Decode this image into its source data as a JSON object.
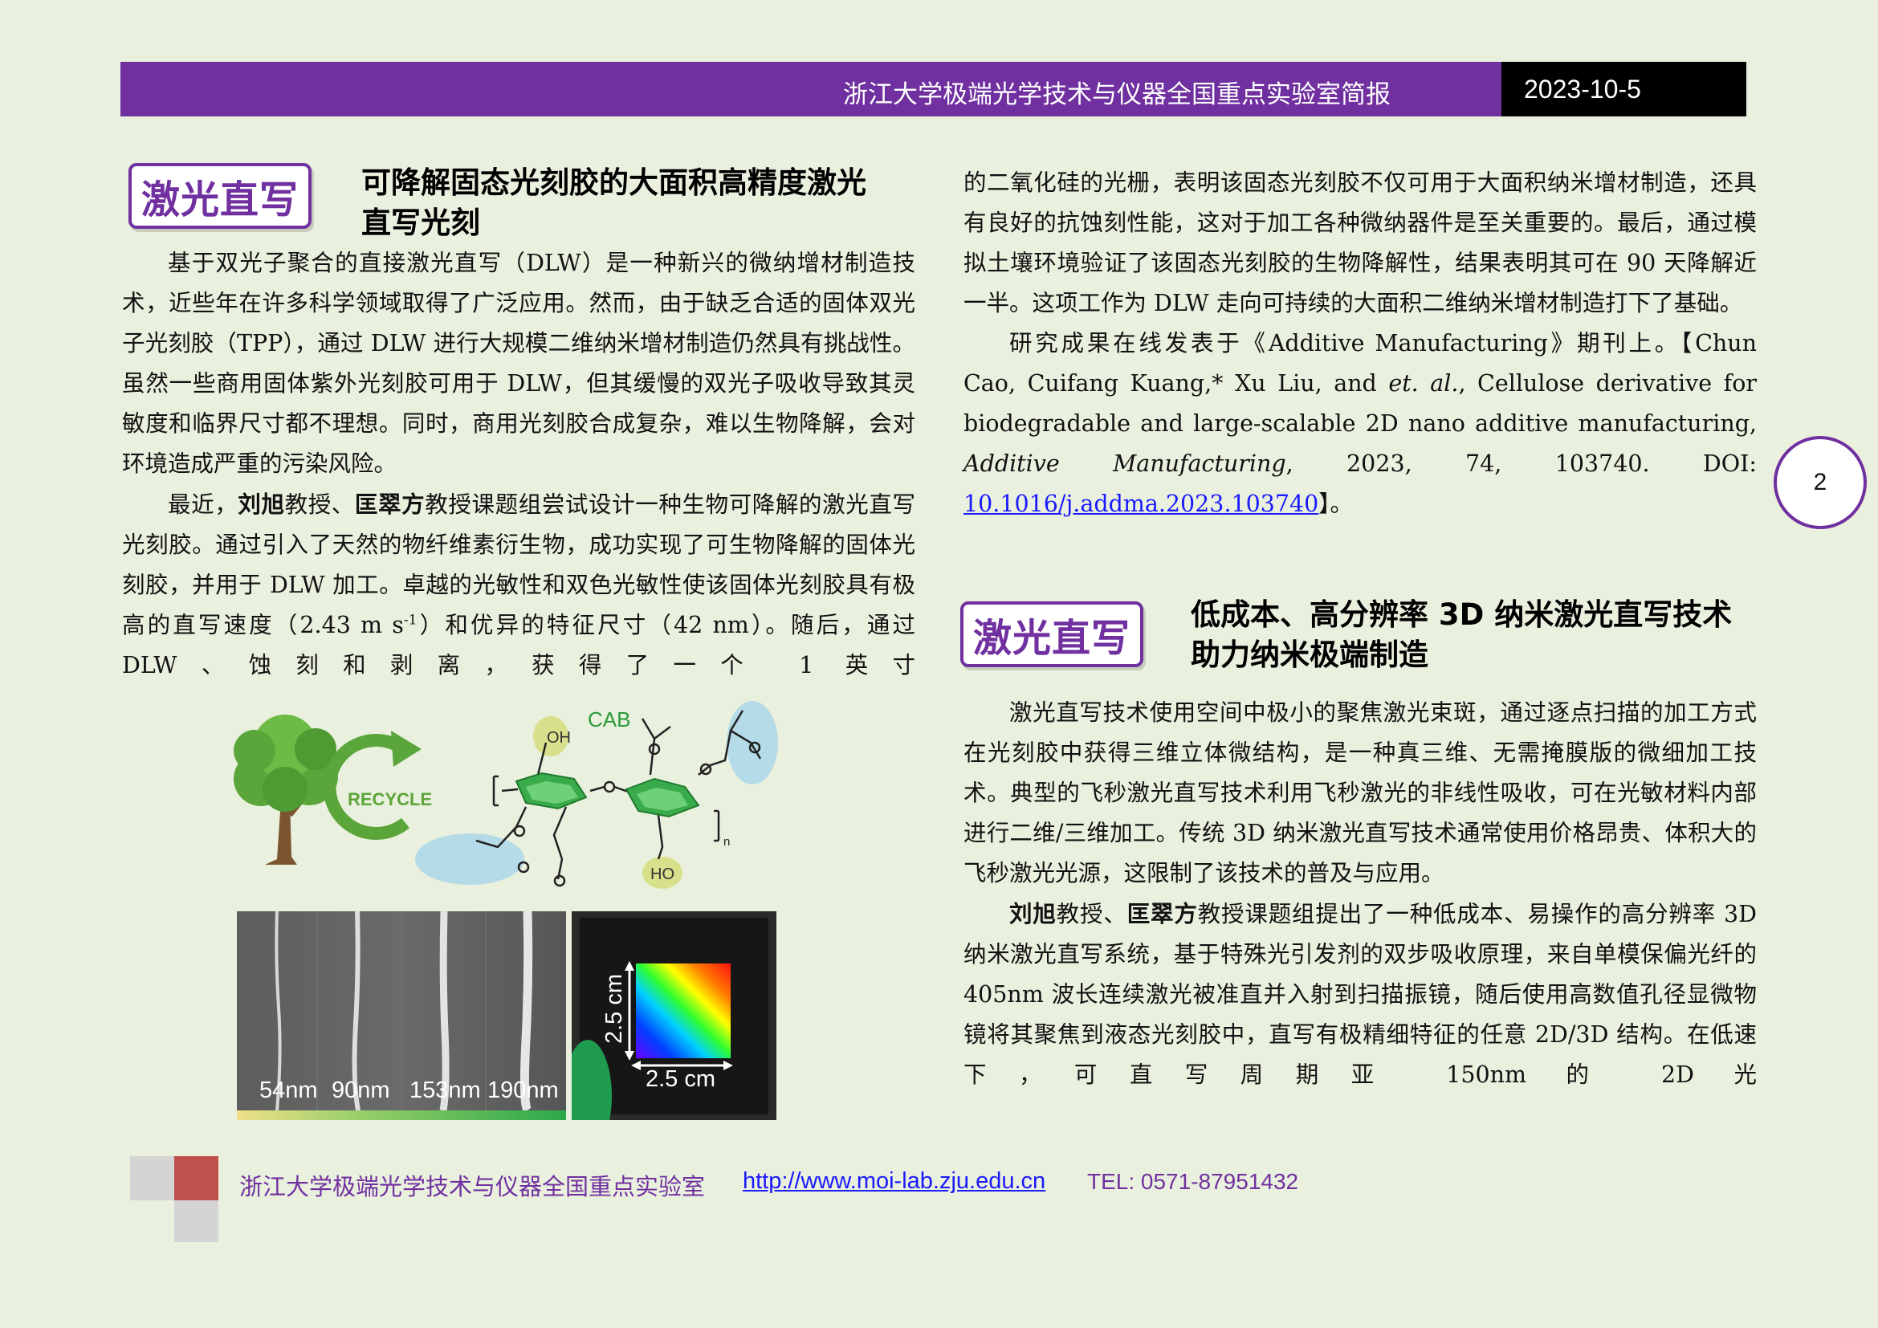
{
  "header": {
    "title": "浙江大学极端光学技术与仪器全国重点实验室简报",
    "date": "2023-10-5"
  },
  "page_number": "2",
  "colors": {
    "accent_purple": "#7030a0",
    "link_blue": "#1a1aff",
    "background": "#eaf0de"
  },
  "article1": {
    "tag": "激光直写",
    "title_line1": "可降解固态光刻胶的大面积高精度激光",
    "title_line2": "直写光刻",
    "p1": "基于双光子聚合的直接激光直写（DLW）是一种新兴的微纳增材制造技术，近些年在许多科学领域取得了广泛应用。然而，由于缺乏合适的固体双光子光刻胶（TPP），通过 DLW 进行大规模二维纳米增材制造仍然具有挑战性。虽然一些商用固体紫外光刻胶可用于 DLW，但其缓慢的双光子吸收导致其灵敏度和临界尺寸都不理想。同时，商用光刻胶合成复杂，难以生物降解，会对环境造成严重的污染风险。",
    "p2_pre": "最近，",
    "p2_name1": "刘旭",
    "p2_mid": "教授、",
    "p2_name2": "匡翠方",
    "p2_post_a": "教授课题组尝试设计一种生物可降解的激光直写光刻胶。通过引入了天然的物纤维素衍生物，成功实现了可生物降解的固体光刻胶，并用于 DLW 加工。卓越的光敏性和双色光敏性使该固体光刻胶具有极高的直写速度（2.43 m s",
    "p2_sup": "-1",
    "p2_post_b": "）和优异的特征尺寸（42 nm）。随后，通过 DLW、蚀刻和剥离，获得了一个 1 英寸",
    "col2_cont": "的二氧化硅的光栅，表明该固态光刻胶不仅可用于大面积纳米增材制造，还具有良好的抗蚀刻性能，这对于加工各种微纳器件是至关重要的。最后，通过模拟土壤环境验证了该固态光刻胶的生物降解性，结果表明其可在 90 天降解近一半。这项工作为 DLW 走向可持续的大面积二维纳米增材制造打下了基础。",
    "pub_a": "研究成果在线发表于《Additive Manufacturing》期刊上。【Chun Cao, Cuifang Kuang,* Xu Liu, and ",
    "pub_etal": "et. al.",
    "pub_b": ", Cellulose derivative for biodegradable and large-scalable 2D nano additive manufacturing, ",
    "pub_journal": "Additive Manufacturing",
    "pub_c": ", 2023, 74, 103740. DOI: ",
    "doi": "10.1016/j.addma.2023.103740",
    "pub_end": "】。"
  },
  "figure": {
    "recycle_label": "RECYCLE",
    "cab_label": "CAB",
    "oh_label": "OH",
    "ho_label": "HO",
    "n_label": "n",
    "sem_labels": [
      "54nm",
      "90nm",
      "153nm",
      "190nm"
    ],
    "dim_vertical": "2.5 cm",
    "dim_horizontal": "2.5 cm"
  },
  "article2": {
    "tag": "激光直写",
    "title_line1": "低成本、高分辨率 3D 纳米激光直写技术",
    "title_line2": "助力纳米极端制造",
    "p1": "激光直写技术使用空间中极小的聚焦激光束斑，通过逐点扫描的加工方式在光刻胶中获得三维立体微结构，是一种真三维、无需掩膜版的微细加工技术。典型的飞秒激光直写技术利用飞秒激光的非线性吸收，可在光敏材料内部进行二维/三维加工。传统 3D 纳米激光直写技术通常使用价格昂贵、体积大的飞秒激光光源，这限制了该技术的普及与应用。",
    "p2_name1": "刘旭",
    "p2_mid": "教授、",
    "p2_name2": "匡翠方",
    "p2_post": "教授课题组提出了一种低成本、易操作的高分辨率 3D 纳米激光直写系统，基于特殊光引发剂的双步吸收原理，来自单模保偏光纤的 405nm 波长连续激光被准直并入射到扫描振镜，随后使用高数值孔径显微物镜将其聚焦到液态光刻胶中，直写有极精细特征的任意 2D/3D 结构。在低速下，可直写周期亚 150nm 的 2D 光"
  },
  "footer": {
    "lab": "浙江大学极端光学技术与仪器全国重点实验室",
    "url": "http://www.moi-lab.zju.edu.cn",
    "tel": "TEL: 0571-87951432"
  }
}
